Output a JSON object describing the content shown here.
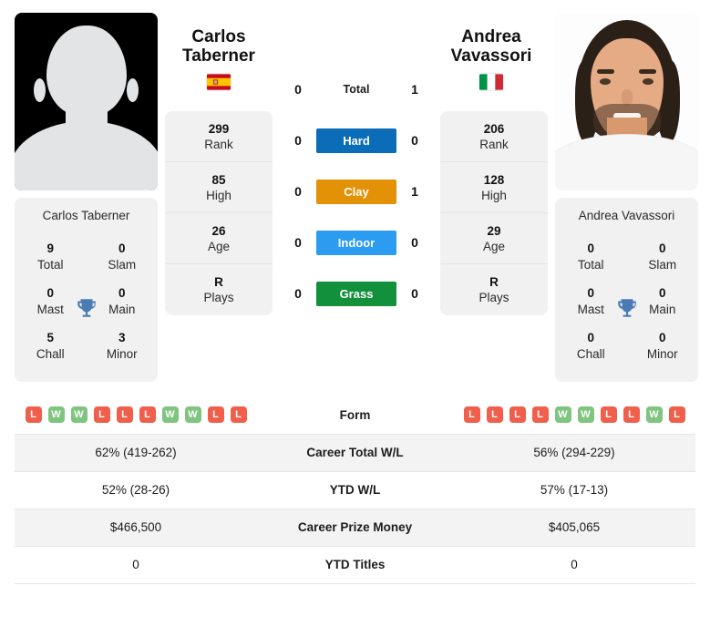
{
  "players": {
    "left": {
      "first_name": "Carlos",
      "last_name": "Taberner",
      "full_name": "Carlos Taberner",
      "country": "Spain",
      "flag_icon": "flag-spain",
      "photo_type": "placeholder-avatar",
      "rank": "299",
      "rank_label": "Rank",
      "high": "85",
      "high_label": "High",
      "age": "26",
      "age_label": "Age",
      "plays": "R",
      "plays_label": "Plays",
      "titles": {
        "total": "9",
        "total_label": "Total",
        "slam": "0",
        "slam_label": "Slam",
        "mast": "0",
        "mast_label": "Mast",
        "main": "0",
        "main_label": "Main",
        "chall": "5",
        "chall_label": "Chall",
        "minor": "3",
        "minor_label": "Minor"
      },
      "form": [
        "L",
        "W",
        "W",
        "L",
        "L",
        "L",
        "W",
        "W",
        "L",
        "L"
      ],
      "career_total_wl": "62% (419-262)",
      "ytd_wl": "52% (28-26)",
      "career_prize_money": "$466,500",
      "ytd_titles": "0"
    },
    "right": {
      "first_name": "Andrea",
      "last_name": "Vavassori",
      "full_name": "Andrea Vavassori",
      "country": "Italy",
      "flag_icon": "flag-italy",
      "photo_type": "portrait-photo",
      "rank": "206",
      "rank_label": "Rank",
      "high": "128",
      "high_label": "High",
      "age": "29",
      "age_label": "Age",
      "plays": "R",
      "plays_label": "Plays",
      "titles": {
        "total": "0",
        "total_label": "Total",
        "slam": "0",
        "slam_label": "Slam",
        "mast": "0",
        "mast_label": "Mast",
        "main": "0",
        "main_label": "Main",
        "chall": "0",
        "chall_label": "Chall",
        "minor": "0",
        "minor_label": "Minor"
      },
      "form": [
        "L",
        "L",
        "L",
        "L",
        "W",
        "W",
        "L",
        "L",
        "W",
        "L"
      ],
      "career_total_wl": "56% (294-229)",
      "ytd_wl": "57% (17-13)",
      "career_prize_money": "$405,065",
      "ytd_titles": "0"
    }
  },
  "h2h": {
    "total": {
      "label": "Total",
      "left": "0",
      "right": "1"
    },
    "surfaces": [
      {
        "label": "Hard",
        "left": "0",
        "right": "0",
        "color": "#0b6cb8"
      },
      {
        "label": "Clay",
        "left": "0",
        "right": "1",
        "color": "#e39207"
      },
      {
        "label": "Indoor",
        "left": "0",
        "right": "0",
        "color": "#2c9cf0"
      },
      {
        "label": "Grass",
        "left": "0",
        "right": "0",
        "color": "#12903c"
      }
    ]
  },
  "table": {
    "rows": [
      {
        "label": "Form",
        "type": "form"
      },
      {
        "label": "Career Total W/L",
        "type": "text",
        "left": "62% (419-262)",
        "right": "56% (294-229)"
      },
      {
        "label": "YTD W/L",
        "type": "text",
        "left": "52% (28-26)",
        "right": "57% (17-13)"
      },
      {
        "label": "Career Prize Money",
        "type": "text",
        "left": "$466,500",
        "right": "$405,065"
      },
      {
        "label": "YTD Titles",
        "type": "text",
        "left": "0",
        "right": "0"
      }
    ]
  },
  "colors": {
    "win": "#7fc47f",
    "loss": "#ef5f4c",
    "card_bg": "#f1f1f1",
    "row_alt": "#f3f3f3",
    "trophy": "#4a7bb5"
  }
}
